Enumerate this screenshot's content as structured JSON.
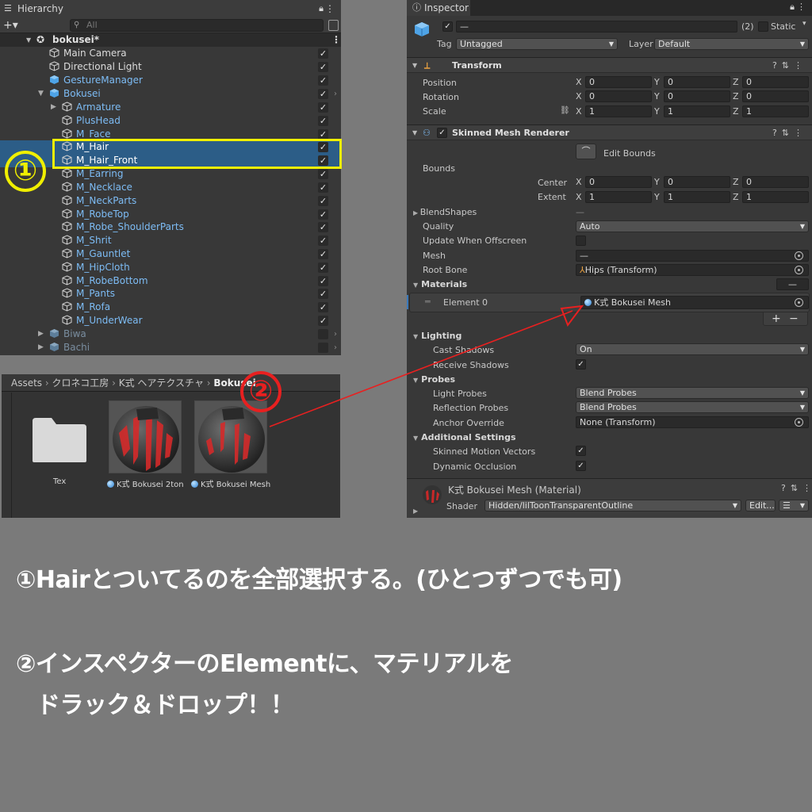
{
  "hierarchy": {
    "title": "Hierarchy",
    "add_label": "+▾",
    "search_placeholder": "All",
    "scene_name": "bokusei*",
    "rows": [
      {
        "label": "Main Camera",
        "checked": true
      },
      {
        "label": "Directional Light",
        "checked": true
      },
      {
        "label": "GestureManager",
        "checked": true
      },
      {
        "label": "Bokusei",
        "checked": true
      },
      {
        "label": "Armature",
        "checked": true
      },
      {
        "label": "PlusHead",
        "checked": true
      },
      {
        "label": "M_Face",
        "checked": true
      },
      {
        "label": "M_Hair",
        "checked": true
      },
      {
        "label": "M_Hair_Front",
        "checked": true
      },
      {
        "label": "M_Earring",
        "checked": true
      },
      {
        "label": "M_Necklace",
        "checked": true
      },
      {
        "label": "M_NeckParts",
        "checked": true
      },
      {
        "label": "M_RobeTop",
        "checked": true
      },
      {
        "label": "M_Robe_ShoulderParts",
        "checked": true
      },
      {
        "label": "M_Shrit",
        "checked": true
      },
      {
        "label": "M_Gauntlet",
        "checked": true
      },
      {
        "label": "M_HipCloth",
        "checked": true
      },
      {
        "label": "M_RobeBottom",
        "checked": true
      },
      {
        "label": "M_Pants",
        "checked": true
      },
      {
        "label": "M_Rofa",
        "checked": true
      },
      {
        "label": "M_UnderWear",
        "checked": true
      },
      {
        "label": "Biwa",
        "checked": false
      },
      {
        "label": "Bachi",
        "checked": false
      }
    ]
  },
  "annotations": {
    "num1": "①",
    "num2": "②",
    "highlight_color": "#f0ef00",
    "arrow_color": "#e82020"
  },
  "project": {
    "breadcrumb": [
      "Assets",
      "クロネコ工房",
      "K式 ヘアテクスチャ",
      "Bokusei"
    ],
    "folder_label": "Tex",
    "assets": [
      {
        "label": "K式 Bokusei 2ton"
      },
      {
        "label": "K式 Bokusei Mesh"
      }
    ]
  },
  "inspector": {
    "title": "Inspector",
    "name_value": "—",
    "count": "(2)",
    "static_label": "Static",
    "tag_label": "Tag",
    "tag_value": "Untagged",
    "layer_label": "Layer",
    "layer_value": "Default",
    "transform": {
      "title": "Transform",
      "position_label": "Position",
      "rotation_label": "Rotation",
      "scale_label": "Scale",
      "position": [
        "0",
        "0",
        "0"
      ],
      "rotation": [
        "0",
        "0",
        "0"
      ],
      "scale": [
        "1",
        "1",
        "1"
      ]
    },
    "axes": [
      "X",
      "Y",
      "Z"
    ],
    "smr": {
      "title": "Skinned Mesh Renderer",
      "edit_bounds": "Edit Bounds",
      "bounds_label": "Bounds",
      "center_label": "Center",
      "extent_label": "Extent",
      "center": [
        "0",
        "0",
        "0"
      ],
      "extent": [
        "1",
        "1",
        "1"
      ],
      "blendshapes_label": "BlendShapes",
      "blendshapes_value": "—",
      "quality_label": "Quality",
      "quality_value": "Auto",
      "update_label": "Update When Offscreen",
      "mesh_label": "Mesh",
      "mesh_value": "—",
      "rootbone_label": "Root Bone",
      "rootbone_value": "Hips (Transform)",
      "materials_label": "Materials",
      "materials_count": "—",
      "element_label": "Element 0",
      "element_value": "K式 Bokusei Mesh",
      "plus": "+",
      "minus": "−",
      "lighting_label": "Lighting",
      "cast_label": "Cast Shadows",
      "cast_value": "On",
      "receive_label": "Receive Shadows",
      "probes_label": "Probes",
      "light_probes_label": "Light Probes",
      "light_probes_value": "Blend Probes",
      "refl_probes_label": "Reflection Probes",
      "refl_probes_value": "Blend Probes",
      "anchor_label": "Anchor Override",
      "anchor_value": "None (Transform)",
      "additional_label": "Additional Settings",
      "motion_label": "Skinned Motion Vectors",
      "dynocc_label": "Dynamic Occlusion"
    },
    "material": {
      "title": "K式 Bokusei Mesh (Material)",
      "shader_label": "Shader",
      "shader_value": "Hidden/lilToonTransparentOutline",
      "edit_label": "Edit..."
    }
  },
  "instructions": {
    "line1": "①Hairとついてるのを全部選択する。(ひとつずつでも可)",
    "line2": "②インスペクターのElementに、マテリアルを",
    "line3": "ドラック＆ドロップ！！"
  }
}
